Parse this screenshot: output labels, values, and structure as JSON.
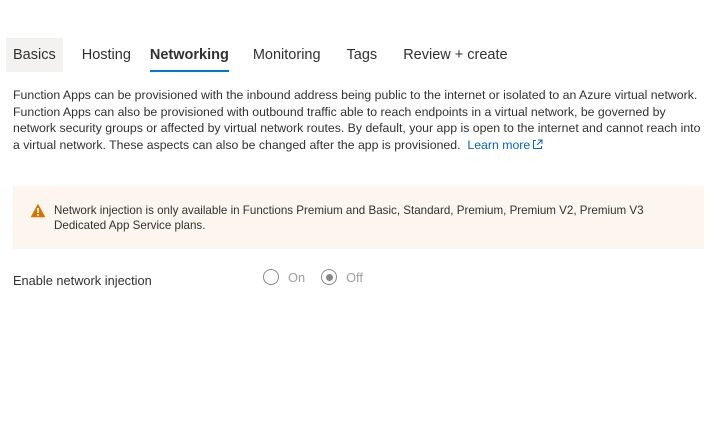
{
  "tabs": [
    {
      "label": "Basics"
    },
    {
      "label": "Hosting"
    },
    {
      "label": "Networking",
      "active": true
    },
    {
      "label": "Monitoring"
    },
    {
      "label": "Tags"
    },
    {
      "label": "Review + create"
    }
  ],
  "description": {
    "text": "Function Apps can be provisioned with the inbound address being public to the internet or isolated to an Azure virtual network. Function Apps can also be provisioned with outbound traffic able to reach endpoints in a virtual network, be governed by network security groups or affected by virtual network routes. By default, your app is open to the internet and cannot reach into a virtual network. These aspects can also be changed after the app is provisioned.",
    "link_label": "Learn more"
  },
  "warning": {
    "icon": "warning-icon",
    "text": "Network injection is only available in Functions Premium and Basic, Standard, Premium, Premium V2, Premium V3 Dedicated App Service plans.",
    "background": "#fdf6ef",
    "icon_color": "#d47500"
  },
  "network_injection": {
    "label": "Enable network injection",
    "options": [
      {
        "label": "On",
        "selected": false
      },
      {
        "label": "Off",
        "selected": true
      }
    ],
    "disabled": true
  },
  "colors": {
    "accent": "#0078d4",
    "link": "#0066cc",
    "text": "#323130"
  }
}
